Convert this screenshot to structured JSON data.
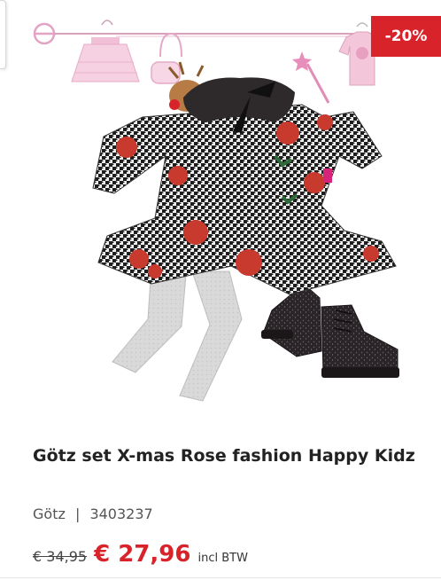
{
  "product": {
    "badge": "-20%",
    "title": "Götz set X-mas Rose fashion Happy Kidz",
    "brand": "Götz",
    "separator": "|",
    "sku": "3403237",
    "old_price": "€ 34,95",
    "new_price": "€ 27,96",
    "vat_note": "incl BTW"
  },
  "colors": {
    "badge_bg": "#d8232a",
    "price": "#d8232a",
    "rose": "#c8392e",
    "houndstooth": "#222222"
  },
  "icons": {
    "product_image": "doll-outfit-photo"
  }
}
